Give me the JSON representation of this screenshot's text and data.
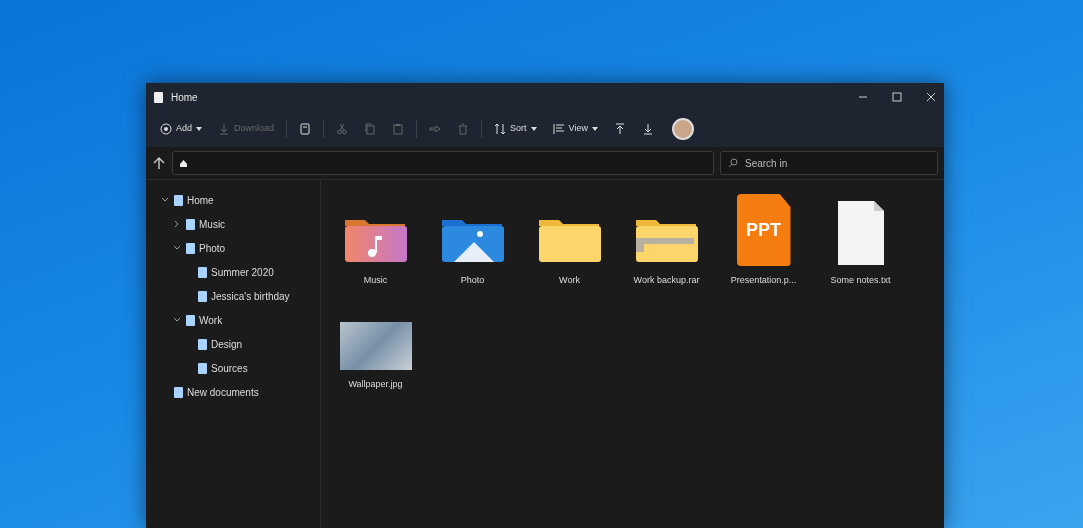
{
  "window": {
    "title": "Home"
  },
  "toolbar": [
    {
      "kind": "add",
      "label": "Add",
      "caret": true,
      "disabled": false
    },
    {
      "kind": "download",
      "label": "Download",
      "caret": false,
      "disabled": true
    },
    {
      "kind": "separator"
    },
    {
      "kind": "rename",
      "disabled": false
    },
    {
      "kind": "separator"
    },
    {
      "kind": "cut",
      "disabled": true
    },
    {
      "kind": "copy",
      "disabled": true
    },
    {
      "kind": "paste",
      "disabled": true
    },
    {
      "kind": "separator"
    },
    {
      "kind": "share",
      "disabled": true
    },
    {
      "kind": "delete",
      "disabled": true
    },
    {
      "kind": "separator"
    },
    {
      "kind": "sort",
      "label": "Sort",
      "caret": true,
      "disabled": false
    },
    {
      "kind": "view",
      "label": "View",
      "caret": true,
      "disabled": false
    },
    {
      "kind": "pin",
      "disabled": false
    },
    {
      "kind": "download",
      "disabled": false
    },
    {
      "kind": "avatar"
    }
  ],
  "search": {
    "placeholder": "Search in"
  },
  "sidebar": {
    "items": [
      {
        "label": "Home",
        "expanded": true,
        "children": [
          {
            "label": "Music",
            "expanded": false
          },
          {
            "label": "Photo",
            "expanded": true,
            "children": [
              {
                "label": "Summer 2020"
              },
              {
                "label": "Jessica's birthday"
              }
            ]
          },
          {
            "label": "Work",
            "expanded": true,
            "children": [
              {
                "label": "Design"
              },
              {
                "label": "Sources"
              }
            ]
          }
        ]
      },
      {
        "label": "New documents"
      }
    ]
  },
  "files": [
    {
      "name": "Music",
      "kind": "music-folder"
    },
    {
      "name": "Photo",
      "kind": "photo-folder"
    },
    {
      "name": "Work",
      "kind": "folder"
    },
    {
      "name": "Work backup.rar",
      "kind": "archive"
    },
    {
      "name": "Presentation.p...",
      "kind": "presentation",
      "badge": "PPT"
    },
    {
      "name": "Some notes.txt",
      "kind": "text"
    },
    {
      "name": "Wallpaper.jpg",
      "kind": "image"
    }
  ]
}
